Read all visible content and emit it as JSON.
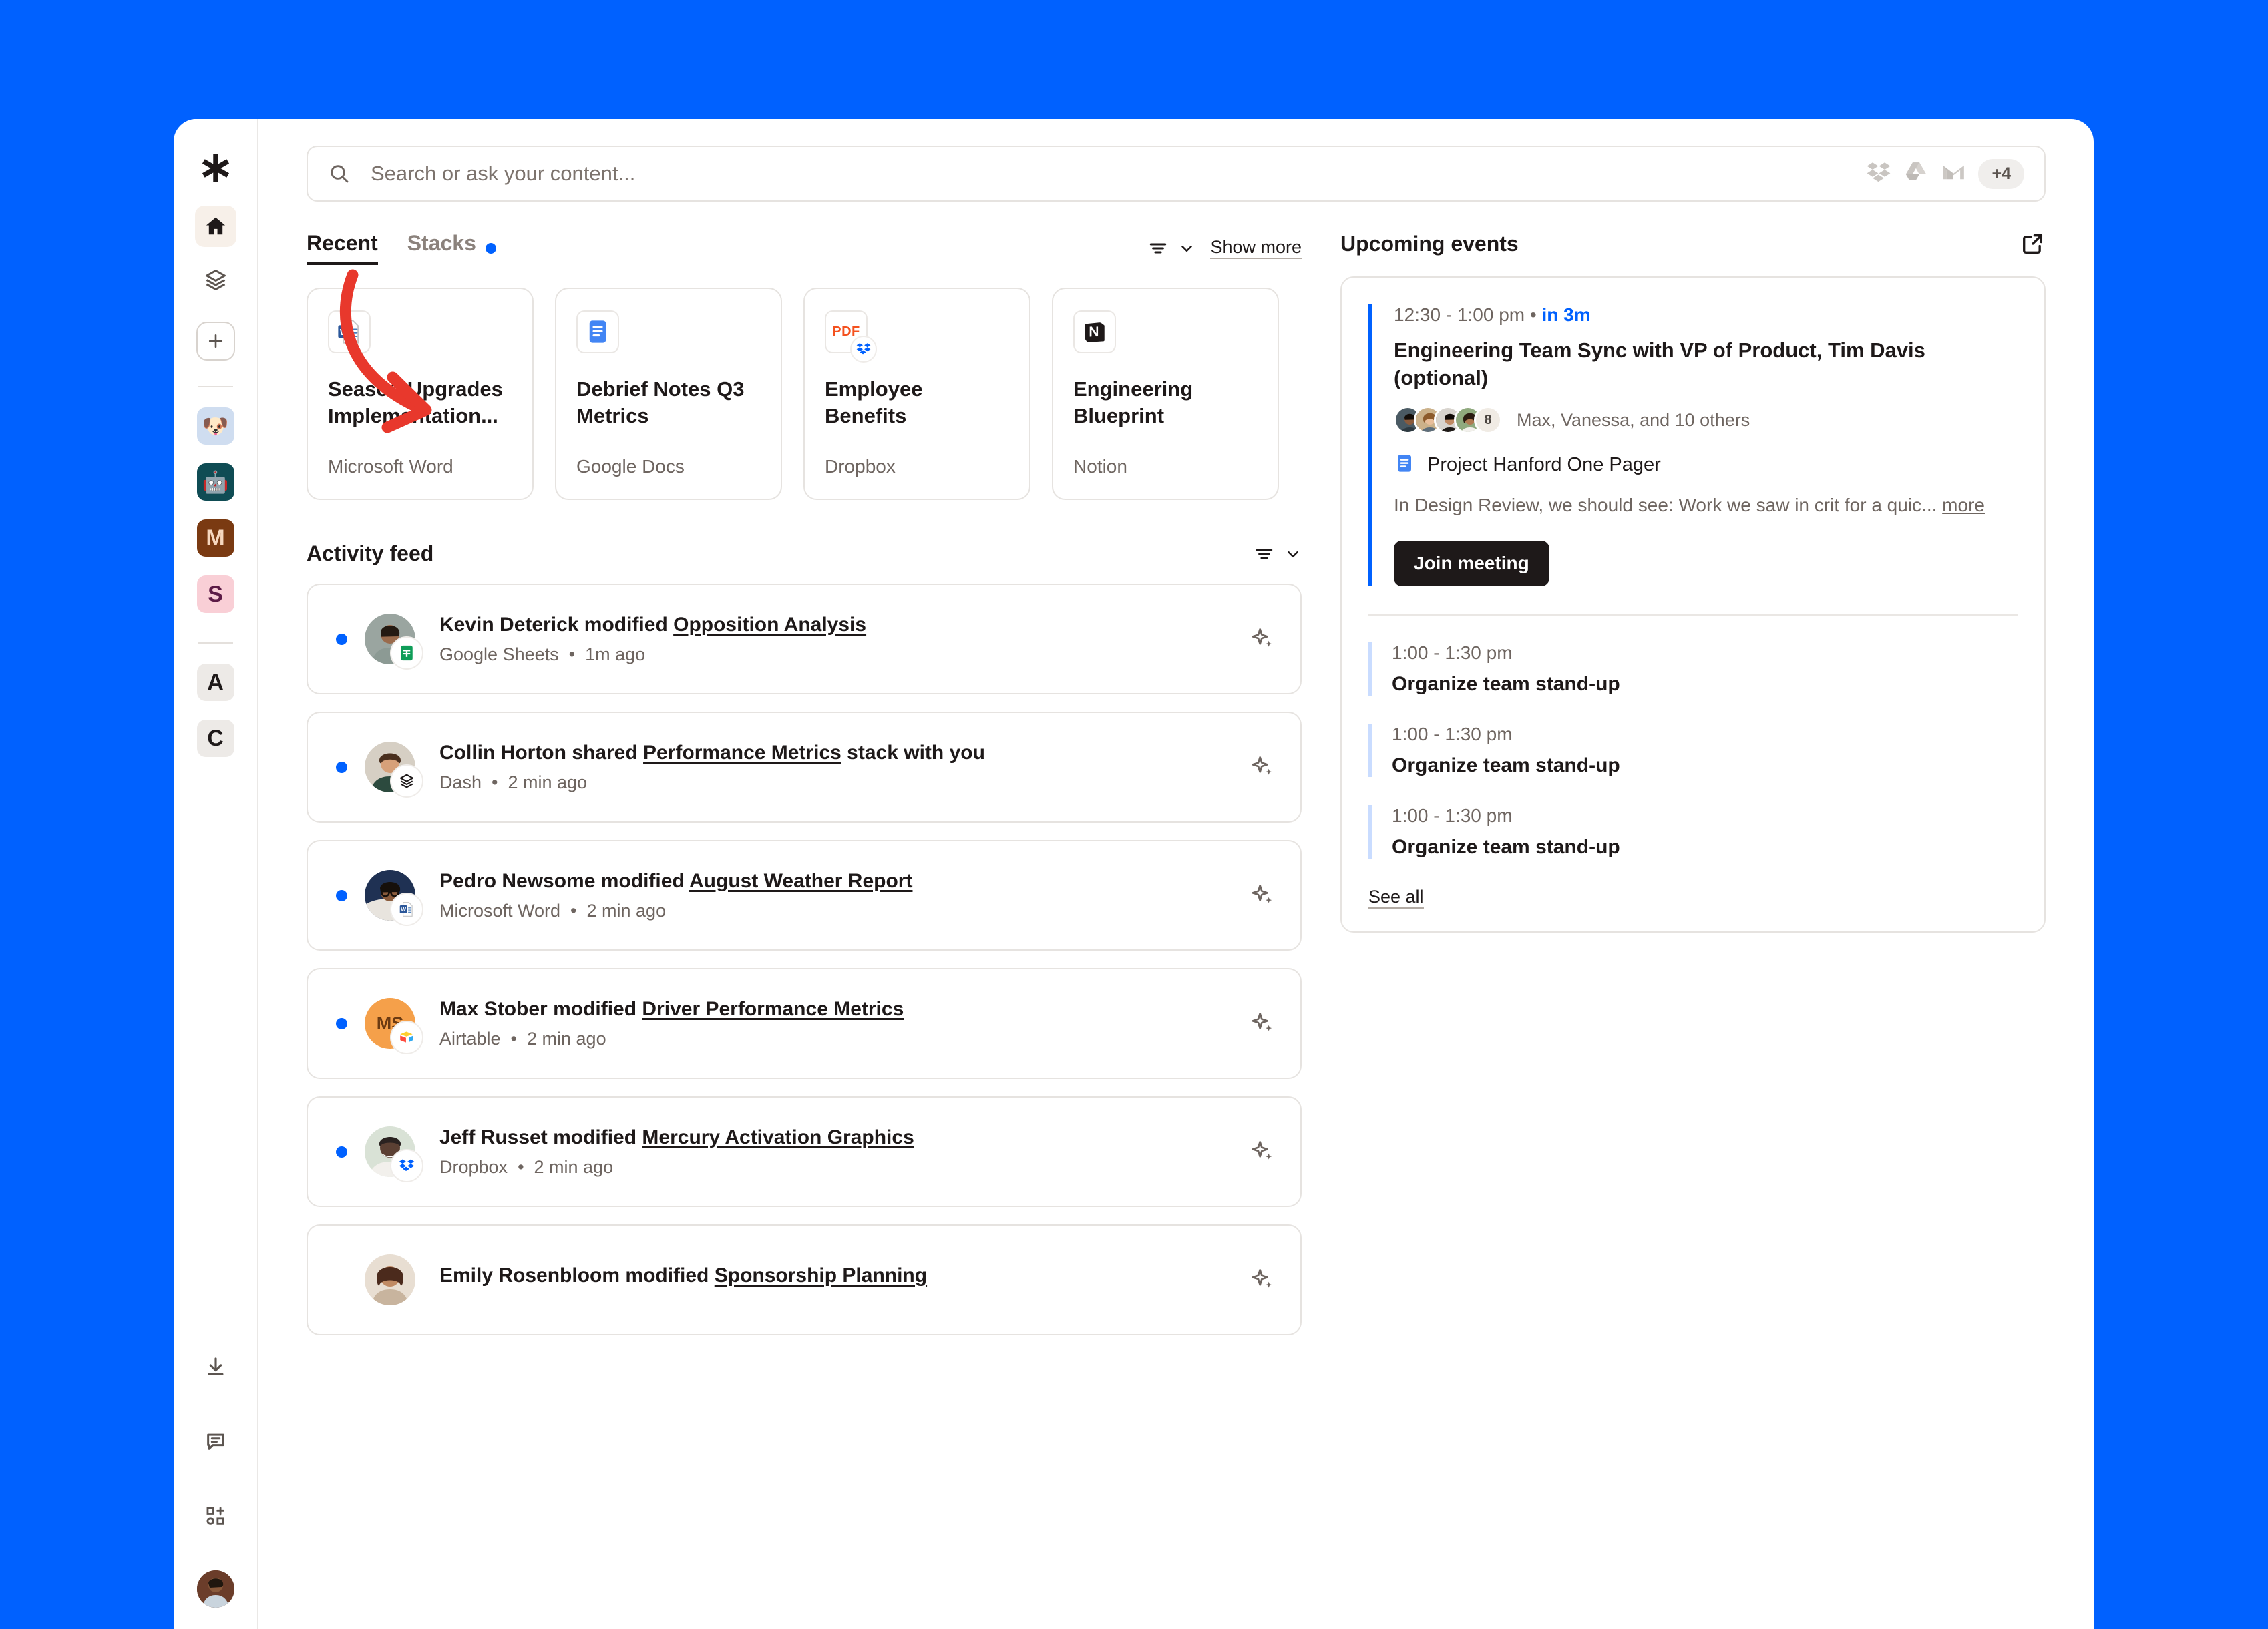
{
  "theme": {
    "background": "#0061FF",
    "accent": "#0061FF",
    "dark": "#1E1919"
  },
  "sidebar": {
    "logo_name": "dash-asterisk-logo",
    "items": [
      {
        "name": "home",
        "label": "Home",
        "active": true
      },
      {
        "name": "stacks",
        "label": "Stacks",
        "active": false
      }
    ],
    "add_label": "+",
    "apps": [
      {
        "name": "dog-emoji-app",
        "glyph": "🐶",
        "bg": "#CFDDF0",
        "fg": "#1E1919"
      },
      {
        "name": "robot-emoji-app",
        "glyph": "🤖",
        "bg": "#0F4C54",
        "fg": "#ffffff"
      },
      {
        "name": "m-app",
        "glyph": "M",
        "bg": "#7A3A12",
        "fg": "#F6D7BE"
      },
      {
        "name": "s-app",
        "glyph": "S",
        "bg": "#F9CFD6",
        "fg": "#5C1B46"
      }
    ],
    "shortcuts": [
      {
        "name": "a-shortcut",
        "glyph": "A",
        "bg": "#EDEAE7",
        "fg": "#1E1919"
      },
      {
        "name": "c-shortcut",
        "glyph": "C",
        "bg": "#EDEAE7",
        "fg": "#1E1919"
      }
    ],
    "bottom": [
      {
        "name": "download-icon",
        "label": "Downloads"
      },
      {
        "name": "feedback-icon",
        "label": "Feedback"
      },
      {
        "name": "apps-add-icon",
        "label": "Add apps"
      }
    ],
    "profile_label": "Account"
  },
  "search": {
    "placeholder": "Search or ask your content...",
    "value": "",
    "connected_apps": [
      "dropbox-icon",
      "google-drive-icon",
      "gmail-icon"
    ],
    "more_badge": "+4"
  },
  "recent": {
    "tabs": [
      {
        "label": "Recent",
        "active": true,
        "dot": false
      },
      {
        "label": "Stacks",
        "active": false,
        "dot": true
      }
    ],
    "show_more_label": "Show more",
    "filter_label": "Filter",
    "cards": [
      {
        "title": "Season Upgrades Implementation...",
        "source": "Microsoft Word",
        "icon": "word-icon",
        "badge": null
      },
      {
        "title": "Debrief Notes Q3 Metrics",
        "source": "Google Docs",
        "icon": "google-docs-icon",
        "badge": null
      },
      {
        "title": "Employee Benefits",
        "source": "Dropbox",
        "icon": "pdf-icon",
        "badge": "dropbox-icon"
      },
      {
        "title": "Engineering Blueprint",
        "source": "Notion",
        "icon": "notion-icon",
        "badge": null
      }
    ]
  },
  "activity": {
    "title": "Activity feed",
    "filter_label": "Filter",
    "rows": [
      {
        "actor": "Kevin Deterick",
        "verb": "modified",
        "object": "Opposition Analysis",
        "suffix": "",
        "source": "Google Sheets",
        "time": "1m ago",
        "app_icon": "google-sheets-icon",
        "avatar_bg": "#8C9A94",
        "unread": true
      },
      {
        "actor": "Collin Horton",
        "verb": "shared",
        "object": "Performance Metrics",
        "suffix": " stack with you",
        "source": "Dash",
        "time": "2 min ago",
        "app_icon": "stacks-icon",
        "avatar_bg": "#4E5B4A",
        "unread": true
      },
      {
        "actor": "Pedro Newsome",
        "verb": "modified",
        "object": "August Weather Report",
        "suffix": "",
        "source": "Microsoft Word",
        "time": "2 min ago",
        "app_icon": "word-icon",
        "avatar_bg": "#2B3A55",
        "unread": true
      },
      {
        "actor": "Max Stober",
        "verb": "modified",
        "object": "Driver Performance Metrics",
        "suffix": "",
        "source": "Airtable",
        "time": "2 min ago",
        "app_icon": "airtable-icon",
        "avatar_bg": "#F5A04A",
        "avatar_initials": "MS",
        "unread": true
      },
      {
        "actor": "Jeff Russet",
        "verb": "modified",
        "object": "Mercury Activation Graphics",
        "suffix": "",
        "source": "Dropbox",
        "time": "2 min ago",
        "app_icon": "dropbox-icon",
        "avatar_bg": "#3F2E26",
        "unread": true
      },
      {
        "actor": "Emily Rosenbloom",
        "verb": "modified",
        "object": "Sponsorship Planning",
        "suffix": "",
        "source": "",
        "time": "",
        "app_icon": "",
        "avatar_bg": "#5A2F26",
        "unread": false
      }
    ],
    "ai_action_label": "Summarize with AI"
  },
  "events": {
    "title": "Upcoming events",
    "open_label": "Open calendar",
    "featured": {
      "time": "12:30 - 1:00 pm",
      "separator": "•",
      "relative": "in 3m",
      "title": "Engineering Team Sync with VP of Product, Tim Davis (optional)",
      "attendees_label": "Max, Vanessa, and 10 others",
      "attendee_overflow": "8",
      "doc_label": "Project Hanford One Pager",
      "doc_icon": "google-docs-icon",
      "description": "In Design Review, we should see: Work we saw in crit for a quic...",
      "more_label": "more",
      "join_label": "Join meeting"
    },
    "items": [
      {
        "time": "1:00 - 1:30 pm",
        "name": "Organize team stand-up"
      },
      {
        "time": "1:00 - 1:30 pm",
        "name": "Organize team stand-up"
      },
      {
        "time": "1:00 - 1:30 pm",
        "name": "Organize team stand-up"
      }
    ],
    "see_all_label": "See all"
  },
  "annotation": {
    "name": "red-curved-arrow",
    "color": "#E8382C",
    "points_to": "Season Upgrades Implementation..."
  }
}
